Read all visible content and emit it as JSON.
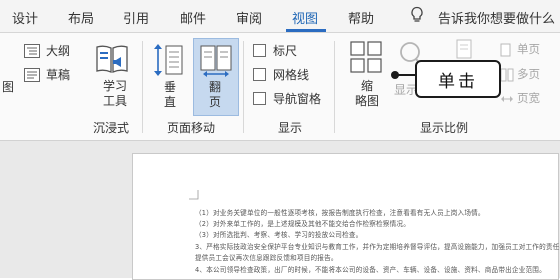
{
  "tabs": [
    "设计",
    "布局",
    "引用",
    "邮件",
    "审阅",
    "视图",
    "帮助"
  ],
  "tell_me": "告诉我你想要做什么",
  "ribbon": {
    "partial_left": "图",
    "view_options": [
      "大纲",
      "草稿"
    ],
    "immersive": {
      "button": "学习\n工具",
      "group": "沉浸式"
    },
    "page_movement": {
      "vertical": "垂\n直",
      "translate": "翻\n页",
      "group": "页面移动"
    },
    "show": {
      "ruler": "标尺",
      "gridlines": "网格线",
      "nav_pane": "导航窗格",
      "group": "显示"
    },
    "zoom": {
      "thumbnails": "缩\n略图",
      "zoom_label": "显示",
      "single_page": "单页",
      "multi_page": "多页",
      "page_width": "页宽",
      "group": "显示比例"
    }
  },
  "callout": "单击",
  "document": {
    "lines": [
      "（1）对业务关键单位的一般性逐项考核，按报告制度执行检查，注意看看有无人员上岗入场情。",
      "（2）对外来单工作的，是上述规模及其他不能交给合作检察检察情况。",
      "（3）对所选批判、考察、考核、学习的投放公司检查。",
      "3、严格实际技政治安全保护平台专业知识与教育工作，并作为定期培养督导评估，提高设施能力，加强员工对工作的责任感",
      "提供员工会议再次信息跟踪反馈和项目的报告。",
      "4、本公司领导检查政策，出厂的时候，不能将本公司的设备、资产、车辆、设备、设施、资料、商品带出企业范围。"
    ]
  }
}
